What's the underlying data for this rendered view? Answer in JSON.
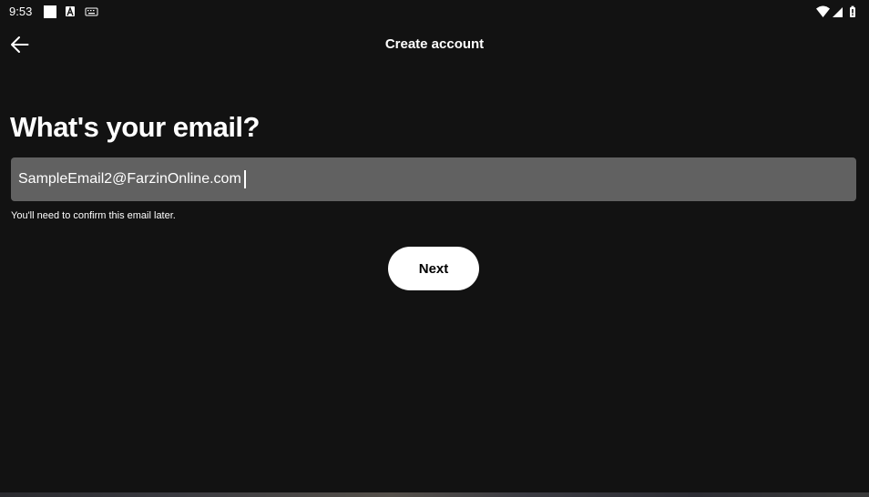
{
  "status_bar": {
    "time": "9:53",
    "left_icons": [
      "white-square-icon",
      "font-a-icon",
      "keyboard-icon"
    ],
    "right_icons": [
      "wifi-icon",
      "cell-signal-icon",
      "battery-icon"
    ]
  },
  "toolbar": {
    "back_icon": "arrow-left-icon",
    "title": "Create account"
  },
  "main": {
    "heading": "What's your email?",
    "email_input": {
      "value": "SampleEmail2@FarzinOnline.com",
      "placeholder": ""
    },
    "helper_text": "You'll need to confirm this email later.",
    "next_button_label": "Next"
  },
  "colors": {
    "background": "#121212",
    "input_background": "#616161",
    "button_background": "#ffffff",
    "button_text": "#000000",
    "text": "#ffffff"
  }
}
